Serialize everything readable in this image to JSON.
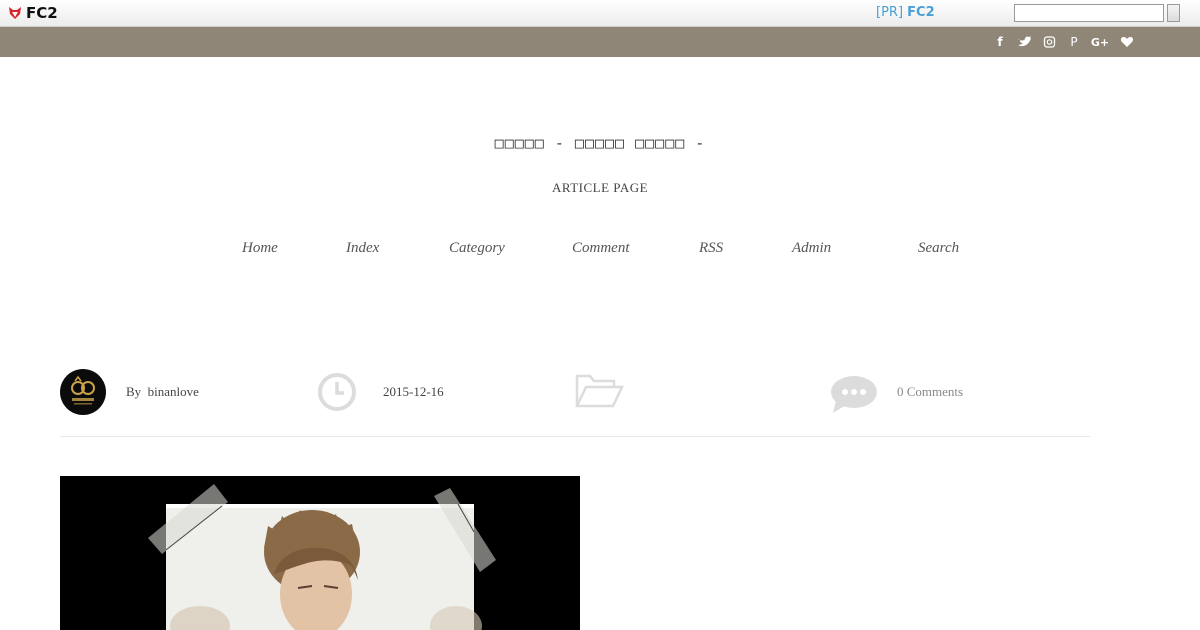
{
  "fc2bar": {
    "logo_text": "FC2",
    "pr_prefix": "[PR]",
    "pr_link": "FC2",
    "search_value": ""
  },
  "social": [
    "f",
    "t",
    "◎",
    "P",
    "G+",
    "♥"
  ],
  "site": {
    "title": "□□□□□ - □□□□□ □□□□□ -",
    "subtitle": "ARTICLE PAGE"
  },
  "nav": {
    "home": "Home",
    "index": "Index",
    "category": "Category",
    "comment": "Comment",
    "rss": "RSS",
    "admin": "Admin",
    "search": "Search"
  },
  "meta": {
    "by_label": "By",
    "author": "binanlove",
    "date": "2015-12-16",
    "comments": "0 Comments"
  },
  "colors": {
    "social_bar": "#8f8677",
    "pr_link": "#4a9fd5"
  }
}
